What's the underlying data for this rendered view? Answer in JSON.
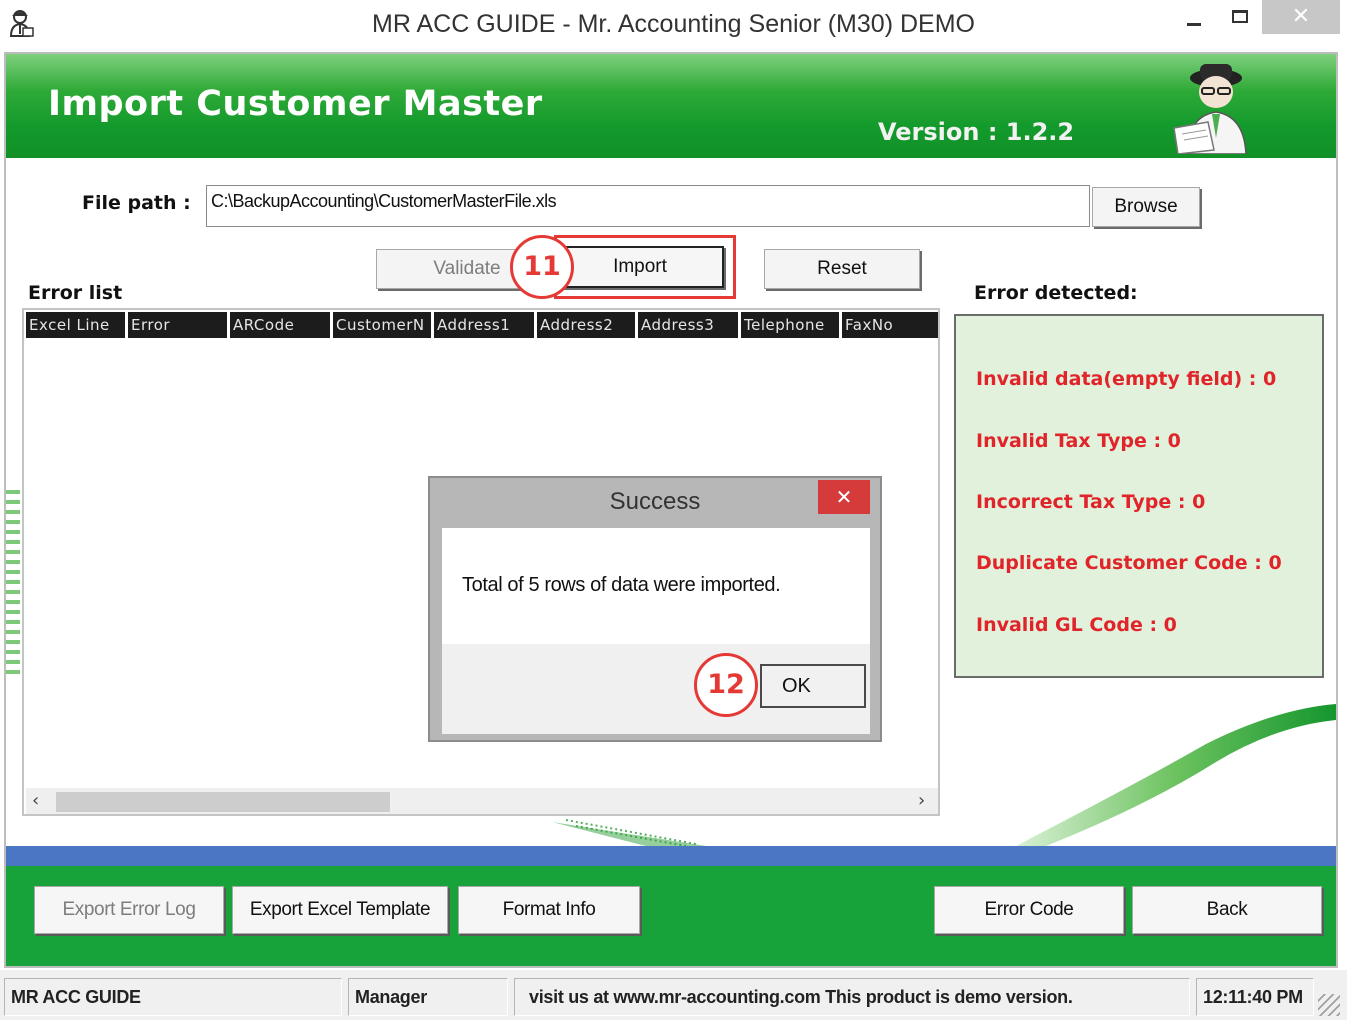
{
  "window": {
    "title": "MR ACC GUIDE - Mr. Accounting Senior (M30) DEMO",
    "close_symbol": "✕",
    "icons": [
      "app-icon",
      "minimize-icon",
      "maximize-icon",
      "close-icon"
    ]
  },
  "header": {
    "title": "Import Customer Master",
    "version": "Version : 1.2.2",
    "mascot_icon": "accountant-mascot-icon"
  },
  "file_path": {
    "label": "File path :",
    "value": "C:\\BackupAccounting\\CustomerMasterFile.xls",
    "browse_label": "Browse"
  },
  "actions": {
    "validate_label": "Validate",
    "import_label": "Import",
    "reset_label": "Reset"
  },
  "annotations": {
    "step_import": "11",
    "step_ok": "12",
    "color": "#e53935"
  },
  "error_list": {
    "label": "Error list",
    "columns": [
      "Excel Line",
      "Error",
      "ARCode",
      "CustomerN",
      "Address1",
      "Address2",
      "Address3",
      "Telephone",
      "FaxNo"
    ],
    "rows": [],
    "scroll_left": "‹",
    "scroll_right": "›"
  },
  "error_detected": {
    "label": "Error detected:",
    "items": [
      "Invalid data(empty field) : 0",
      "Invalid Tax Type : 0",
      "Incorrect Tax Type : 0",
      "Duplicate Customer Code : 0",
      "Invalid GL Code : 0"
    ],
    "text_color": "#e0242a",
    "background": "#e1f1dc"
  },
  "dialog": {
    "title": "Success",
    "close_symbol": "✕",
    "message": "Total of 5 rows of data were imported.",
    "ok_label": "OK"
  },
  "bottom_buttons": {
    "export_error_log": "Export Error Log",
    "export_excel_template": "Export Excel Template",
    "format_info": "Format Info",
    "error_code": "Error Code",
    "back": "Back"
  },
  "statusbar": {
    "app_name": "MR ACC GUIDE",
    "user": "Manager",
    "message": "visit us at www.mr-accounting.com This product is demo version.",
    "time": "12:11:40 PM"
  },
  "colors": {
    "brand_green": "#139a2c",
    "accent_blue": "#4a76c4",
    "dialog_close_red": "#d63b3b"
  }
}
